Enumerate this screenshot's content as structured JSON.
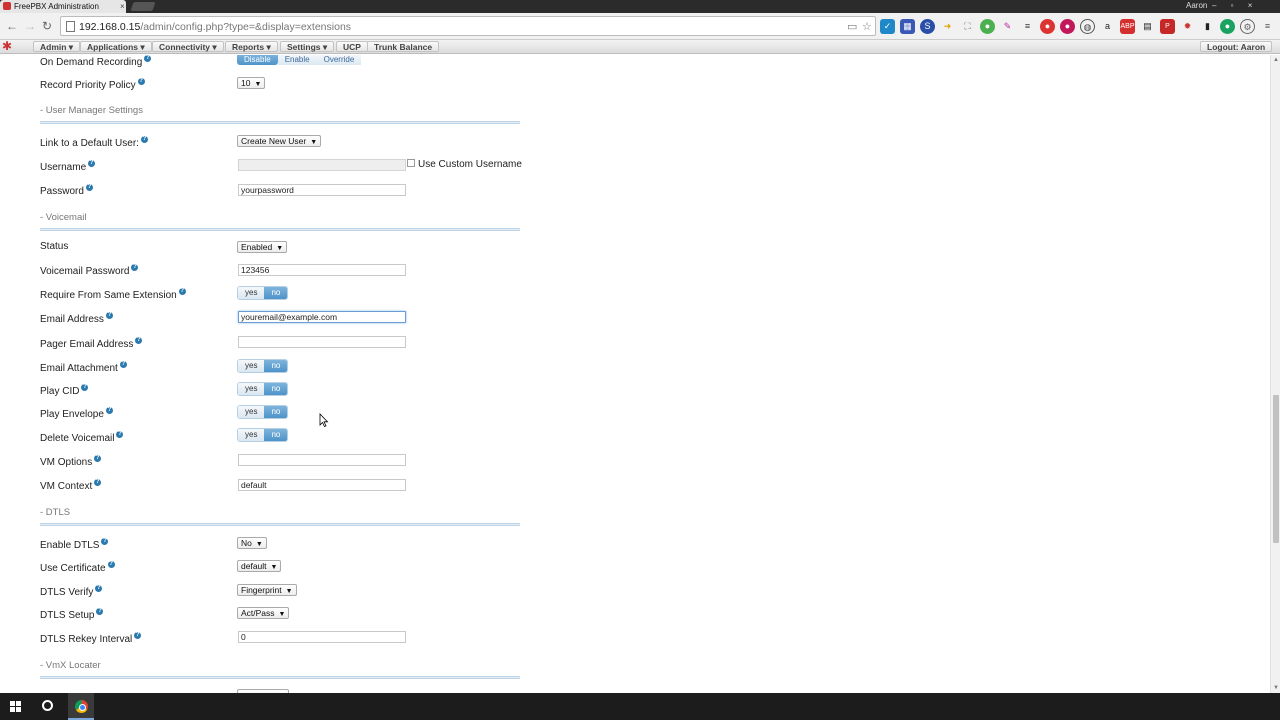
{
  "browser": {
    "tab_title": "FreePBX Administration",
    "tab_close": "×",
    "user": "Aaron",
    "window_controls": "– ▫ ×",
    "url_main": "192.168.0.15",
    "url_rest": "/admin/config.php?type=&display=extensions"
  },
  "nav": {
    "logo": "✱",
    "menus": [
      "Admin ▾",
      "Applications ▾",
      "Connectivity ▾",
      "Reports ▾",
      "Settings ▾",
      "UCP",
      "Trunk Balance"
    ],
    "logout": "Logout: Aaron"
  },
  "form": {
    "on_demand_recording": {
      "label": "On Demand Recording",
      "options": [
        "Disable",
        "Enable",
        "Override"
      ],
      "selected": "Disable"
    },
    "record_priority": {
      "label": "Record Priority Policy",
      "value": "10"
    },
    "section_user_manager": "- User Manager Settings",
    "link_default_user": {
      "label": "Link to a Default User:",
      "value": "Create New User"
    },
    "username": {
      "label": "Username",
      "value": "",
      "custom_label": "Use Custom Username"
    },
    "password": {
      "label": "Password",
      "value": "yourpassword"
    },
    "section_voicemail": "- Voicemail",
    "status": {
      "label": "Status",
      "value": "Enabled"
    },
    "vm_password": {
      "label": "Voicemail Password",
      "value": "123456"
    },
    "require_same_ext": {
      "label": "Require From Same Extension",
      "yes": "yes",
      "no": "no"
    },
    "email_address": {
      "label": "Email Address",
      "value": "youremail@example.com"
    },
    "pager_email": {
      "label": "Pager Email Address",
      "value": ""
    },
    "email_attachment": {
      "label": "Email Attachment",
      "yes": "yes",
      "no": "no"
    },
    "play_cid": {
      "label": "Play CID",
      "yes": "yes",
      "no": "no"
    },
    "play_envelope": {
      "label": "Play Envelope",
      "yes": "yes",
      "no": "no"
    },
    "delete_voicemail": {
      "label": "Delete Voicemail",
      "yes": "yes",
      "no": "no"
    },
    "vm_options": {
      "label": "VM Options",
      "value": ""
    },
    "vm_context": {
      "label": "VM Context",
      "value": "default"
    },
    "section_dtls": "- DTLS",
    "enable_dtls": {
      "label": "Enable DTLS",
      "value": "No"
    },
    "use_certificate": {
      "label": "Use Certificate",
      "value": "default"
    },
    "dtls_verify": {
      "label": "DTLS Verify",
      "value": "Fingerprint"
    },
    "dtls_setup": {
      "label": "DTLS Setup",
      "value": "Act/Pass"
    },
    "dtls_rekey": {
      "label": "DTLS Rekey Interval",
      "value": "0"
    },
    "section_vmx": "- VmX Locater"
  },
  "help_glyph": "?",
  "select_arrow": "▼"
}
